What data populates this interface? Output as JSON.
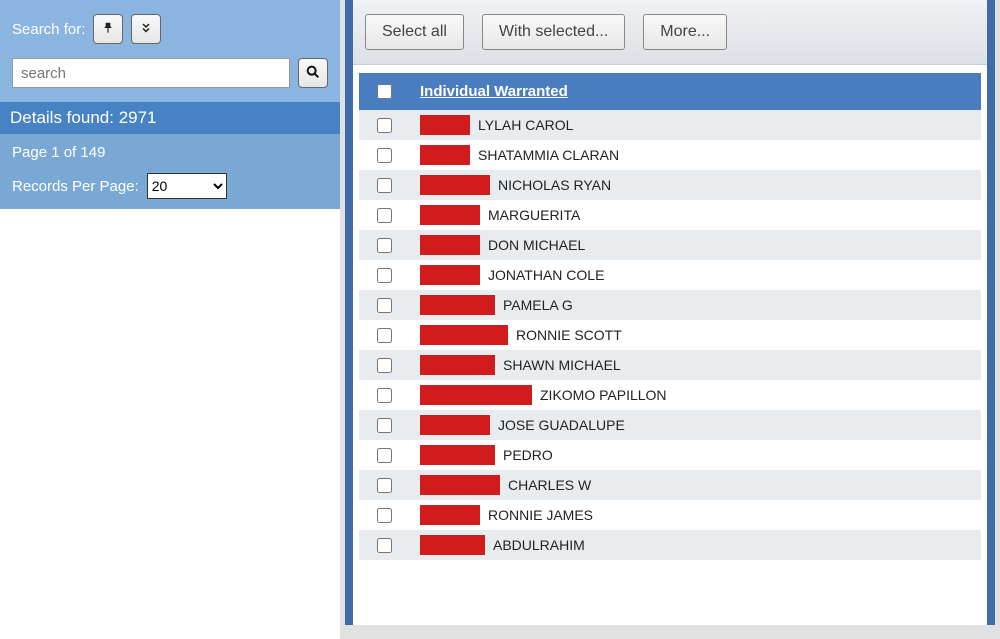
{
  "sidebar": {
    "search_label": "Search for:",
    "search_placeholder": "search",
    "search_value": "",
    "details_prefix": "Details found: ",
    "details_count": "2971",
    "page_info": "Page 1 of 149",
    "records_label": "Records Per Page:",
    "records_value": "20"
  },
  "toolbar": {
    "select_all": "Select all",
    "with_selected": "With selected...",
    "more": "More..."
  },
  "table": {
    "column_header": "Individual Warranted",
    "rows": [
      {
        "redact_w": 50,
        "name": "LYLAH CAROL"
      },
      {
        "redact_w": 50,
        "name": "SHATAMMIA CLARAN"
      },
      {
        "redact_w": 70,
        "name": "NICHOLAS RYAN"
      },
      {
        "redact_w": 60,
        "name": "MARGUERITA"
      },
      {
        "redact_w": 60,
        "name": "DON MICHAEL"
      },
      {
        "redact_w": 60,
        "name": "JONATHAN COLE"
      },
      {
        "redact_w": 75,
        "name": "PAMELA G"
      },
      {
        "redact_w": 88,
        "name": "RONNIE SCOTT"
      },
      {
        "redact_w": 75,
        "name": "SHAWN MICHAEL"
      },
      {
        "redact_w": 112,
        "name": "ZIKOMO PAPILLON"
      },
      {
        "redact_w": 70,
        "name": "JOSE GUADALUPE"
      },
      {
        "redact_w": 75,
        "name": "PEDRO"
      },
      {
        "redact_w": 80,
        "name": "CHARLES W"
      },
      {
        "redact_w": 60,
        "name": "RONNIE JAMES"
      },
      {
        "redact_w": 65,
        "name": "ABDULRAHIM"
      }
    ]
  }
}
